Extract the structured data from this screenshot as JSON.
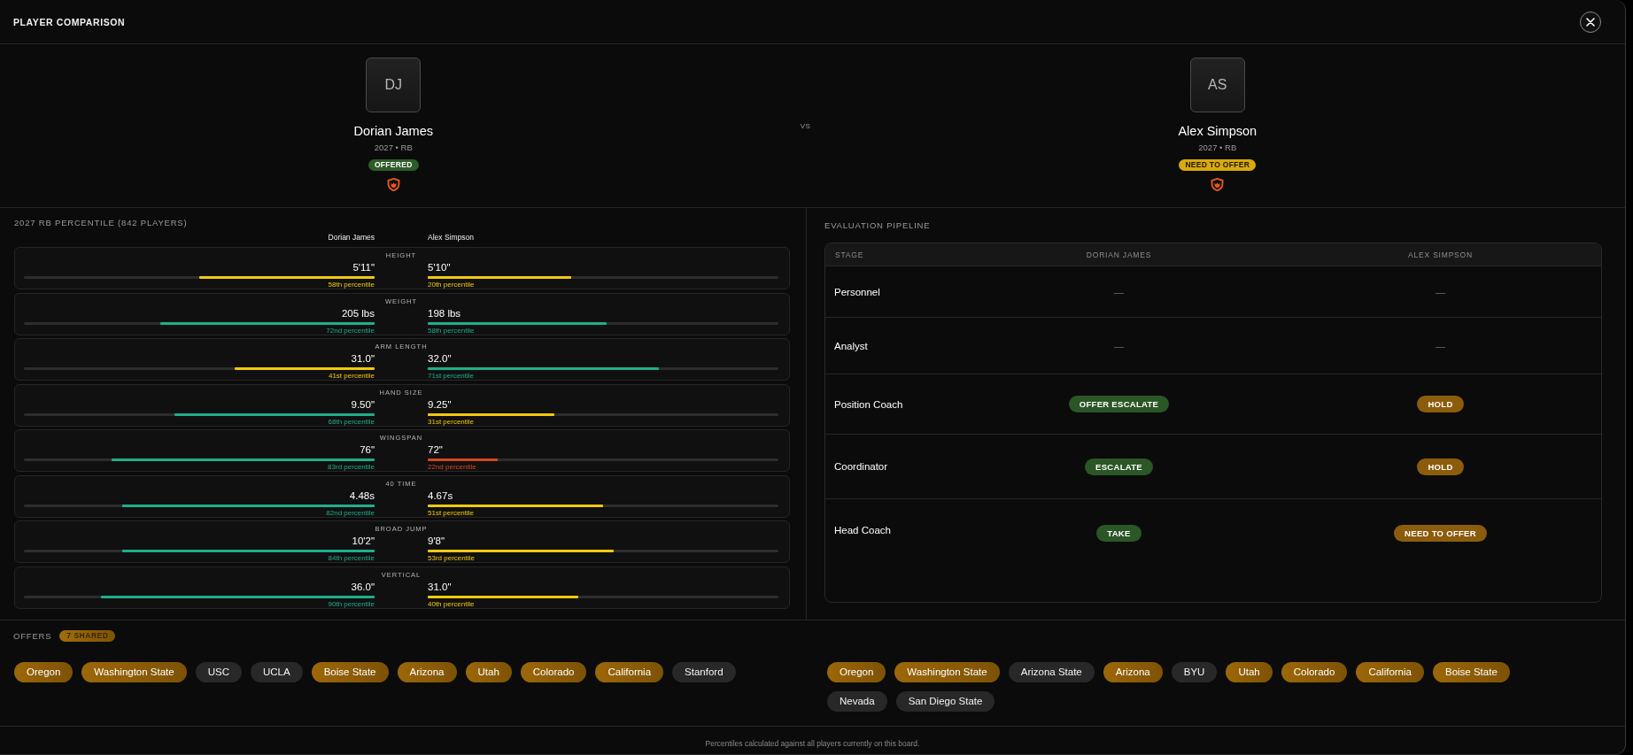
{
  "window": {
    "title": "PLAYER COMPARISON"
  },
  "players": [
    {
      "initials": "DJ",
      "name": "Dorian James",
      "meta": "2027 • RB",
      "status": {
        "text": "OFFERED",
        "color": "#2e5c29"
      }
    },
    {
      "initials": "AS",
      "name": "Alex Simpson",
      "meta": "2027 • RB",
      "status": {
        "text": "NEED TO OFFER",
        "color": "#d9a90f"
      }
    }
  ],
  "vs": "VS",
  "percentiles": {
    "title": "2027 RB PERCENTILE (842 PLAYERS)",
    "columns": [
      "Dorian James",
      "Alex Simpson"
    ],
    "metrics": [
      {
        "label": "HEIGHT",
        "left": {
          "value": "5'11\"",
          "percentile": "58th percentile",
          "level": 0.5,
          "color": "#f2c811"
        },
        "right": {
          "value": "5'10\"",
          "percentile": "20th percentile",
          "level": 0.41,
          "color": "#f2c811"
        }
      },
      {
        "label": "WEIGHT",
        "left": {
          "value": "205 lbs",
          "percentile": "72nd percentile",
          "level": 0.61,
          "color": "#1fae8c"
        },
        "right": {
          "value": "198 lbs",
          "percentile": "58th percentile",
          "level": 0.51,
          "color": "#1fae8c"
        }
      },
      {
        "label": "ARM LENGTH",
        "left": {
          "value": "31.0\"",
          "percentile": "41st percentile",
          "level": 0.4,
          "color": "#f2c811"
        },
        "right": {
          "value": "32.0\"",
          "percentile": "71st percentile",
          "level": 0.66,
          "color": "#1fae8c"
        }
      },
      {
        "label": "HAND SIZE",
        "left": {
          "value": "9.50\"",
          "percentile": "68th percentile",
          "level": 0.57,
          "color": "#1fae8c"
        },
        "right": {
          "value": "9.25\"",
          "percentile": "31st percentile",
          "level": 0.36,
          "color": "#f2c811"
        }
      },
      {
        "label": "WINGSPAN",
        "left": {
          "value": "76\"",
          "percentile": "83rd percentile",
          "level": 0.75,
          "color": "#1fae8c"
        },
        "right": {
          "value": "72\"",
          "percentile": "22nd percentile",
          "level": 0.2,
          "color": "#d9461e"
        }
      },
      {
        "label": "40 TIME",
        "left": {
          "value": "4.48s",
          "percentile": "82nd percentile",
          "level": 0.72,
          "color": "#1fae8c"
        },
        "right": {
          "value": "4.67s",
          "percentile": "51st percentile",
          "level": 0.5,
          "color": "#f2c811"
        }
      },
      {
        "label": "BROAD JUMP",
        "left": {
          "value": "10'2\"",
          "percentile": "84th percentile",
          "level": 0.72,
          "color": "#1fae8c"
        },
        "right": {
          "value": "9'8\"",
          "percentile": "53rd percentile",
          "level": 0.53,
          "color": "#f2c811"
        }
      },
      {
        "label": "VERTICAL",
        "left": {
          "value": "36.0\"",
          "percentile": "90th percentile",
          "level": 0.78,
          "color": "#1fae8c"
        },
        "right": {
          "value": "31.0\"",
          "percentile": "40th percentile",
          "level": 0.43,
          "color": "#f2c811"
        }
      }
    ]
  },
  "pipeline": {
    "title": "EVALUATION PIPELINE",
    "columns": [
      "STAGE",
      "DORIAN JAMES",
      "ALEX SIMPSON"
    ],
    "rows": [
      {
        "cells": [
          {
            "kind": "stage",
            "text": "Personnel"
          },
          {
            "kind": "dash",
            "text": "—"
          },
          {
            "kind": "dash",
            "text": "—"
          }
        ]
      },
      {
        "cells": [
          {
            "kind": "stage",
            "text": "Analyst"
          },
          {
            "kind": "dash",
            "text": "—"
          },
          {
            "kind": "dash",
            "text": "—"
          }
        ]
      },
      {
        "cells": [
          {
            "kind": "stage",
            "text": "Position Coach"
          },
          {
            "kind": "badge",
            "text": "OFFER ESCALATE",
            "color": "#2b5626"
          },
          {
            "kind": "badge",
            "text": "HOLD",
            "color": "#8c5c0d"
          }
        ]
      },
      {
        "cells": [
          {
            "kind": "stage",
            "text": "Coordinator"
          },
          {
            "kind": "badge",
            "text": "ESCALATE",
            "color": "#2b5626"
          },
          {
            "kind": "badge",
            "text": "HOLD",
            "color": "#8c5c0d"
          }
        ]
      },
      {
        "cells": [
          {
            "kind": "stage",
            "text": "Head Coach"
          },
          {
            "kind": "badge",
            "text": "TAKE",
            "color": "#2b5626"
          },
          {
            "kind": "badge",
            "text": "NEED TO OFFER",
            "color": "#8c5c0d"
          }
        ]
      }
    ]
  },
  "offers": {
    "label": "OFFERS",
    "shared_label": "7 SHARED",
    "players": [
      {
        "schools": [
          {
            "name": "Oregon",
            "shared": true
          },
          {
            "name": "Washington State",
            "shared": true
          },
          {
            "name": "USC",
            "shared": false
          },
          {
            "name": "UCLA",
            "shared": false
          },
          {
            "name": "Boise State",
            "shared": true
          },
          {
            "name": "Arizona",
            "shared": true
          },
          {
            "name": "Utah",
            "shared": true
          },
          {
            "name": "Colorado",
            "shared": true
          },
          {
            "name": "California",
            "shared": true
          },
          {
            "name": "Stanford",
            "shared": false
          }
        ]
      },
      {
        "schools": [
          {
            "name": "Oregon",
            "shared": true
          },
          {
            "name": "Washington State",
            "shared": true
          },
          {
            "name": "Arizona State",
            "shared": false
          },
          {
            "name": "Arizona",
            "shared": true
          },
          {
            "name": "BYU",
            "shared": false
          },
          {
            "name": "Utah",
            "shared": true
          },
          {
            "name": "Colorado",
            "shared": true
          },
          {
            "name": "California",
            "shared": true
          },
          {
            "name": "Boise State",
            "shared": true
          },
          {
            "name": "Nevada",
            "shared": false
          },
          {
            "name": "San Diego State",
            "shared": false
          }
        ]
      }
    ]
  },
  "footer": {
    "note": "Percentiles calculated against all players currently on this board."
  }
}
